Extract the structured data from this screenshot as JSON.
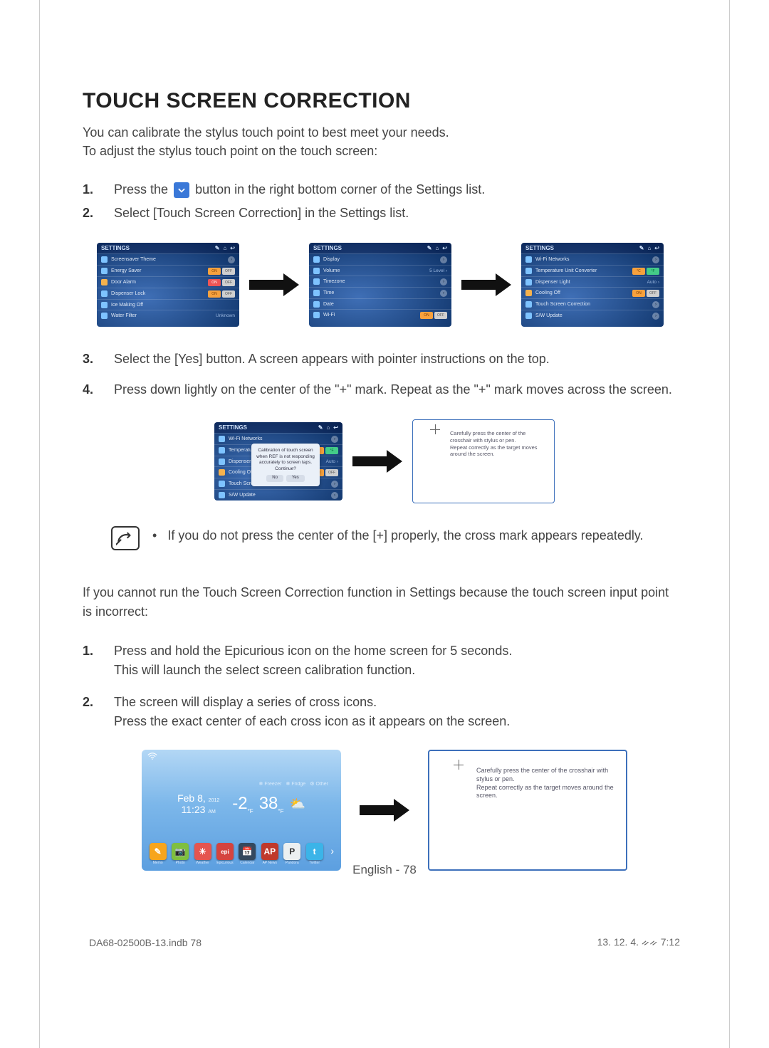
{
  "title": "TOUCH SCREEN CORRECTION",
  "intro_line1": "You can calibrate the stylus touch point to best meet your needs.",
  "intro_line2": "To adjust the stylus touch point on the touch screen:",
  "steps_a": [
    {
      "num": "1.",
      "pre": "Press the ",
      "post": " button in the right bottom corner of the Settings list."
    },
    {
      "num": "2.",
      "text": "Select [Touch Screen Correction] in the Settings list."
    }
  ],
  "settings_header": "SETTINGS",
  "header_icons": {
    "edit": "✎",
    "home": "⌂",
    "back": "↩"
  },
  "screens": {
    "s1": [
      {
        "icon": "#7ec3ff",
        "label": "Screensaver Theme",
        "ctrl": "chev"
      },
      {
        "icon": "#7ec3ff",
        "label": "Energy Saver",
        "ctrl": "onoff"
      },
      {
        "icon": "#f6b24d",
        "label": "Door Alarm",
        "ctrl": "onoff_red"
      },
      {
        "icon": "#7ec3ff",
        "label": "Dispenser Lock",
        "ctrl": "onoff"
      },
      {
        "icon": "#7ec3ff",
        "label": "Ice Making Off",
        "ctrl": "none"
      },
      {
        "icon": "#7ec3ff",
        "label": "Water Filter",
        "ctrl": "muted",
        "right": "Unknown"
      }
    ],
    "s2": [
      {
        "icon": "#7ec3ff",
        "label": "Display",
        "ctrl": "chev"
      },
      {
        "icon": "#7ec3ff",
        "label": "Volume",
        "ctrl": "muted",
        "right": "5 Level ›"
      },
      {
        "icon": "#7ec3ff",
        "label": "Timezone",
        "ctrl": "chev"
      },
      {
        "icon": "#7ec3ff",
        "label": "Time",
        "ctrl": "chev"
      },
      {
        "icon": "#7ec3ff",
        "label": "Date",
        "ctrl": "none"
      },
      {
        "icon": "#7ec3ff",
        "label": "Wi-Fi",
        "ctrl": "onoff"
      }
    ],
    "s3": [
      {
        "icon": "#7ec3ff",
        "label": "Wi-Fi Networks",
        "ctrl": "chev"
      },
      {
        "icon": "#7ec3ff",
        "label": "Temperature Unit Converter",
        "ctrl": "cf"
      },
      {
        "icon": "#7ec3ff",
        "label": "Dispenser Light",
        "ctrl": "muted",
        "right": "Auto ›"
      },
      {
        "icon": "#f6b24d",
        "label": "Cooling Off",
        "ctrl": "onoff"
      },
      {
        "icon": "#7ec3ff",
        "label": "Touch Screen Correction",
        "ctrl": "chev"
      },
      {
        "icon": "#7ec3ff",
        "label": "S/W Update",
        "ctrl": "chev"
      }
    ]
  },
  "steps_b": [
    {
      "num": "3.",
      "text": "Select the [Yes] button. A screen appears with pointer instructions on the top."
    },
    {
      "num": "4.",
      "text": "Press down lightly on the center of the \"+\" mark. Repeat as the \"+\" mark moves across the screen."
    }
  ],
  "dialog": {
    "line1": "Calibration of touch screen",
    "line2": "when REF is not responding",
    "line3": "accurately to screen taps.",
    "line4": "Continue?",
    "no": "No",
    "yes": "Yes"
  },
  "calib_msg_line1": "Carefully press the center of the crosshair with stylus or pen.",
  "calib_msg_line2": "Repeat correctly as the target moves around the screen.",
  "note_bullet": "•",
  "note_text": "If you do not press the center of the [+] properly, the cross mark appears repeatedly.",
  "para2_line1": "If you cannot run the Touch Screen Correction function in Settings because the touch screen input point",
  "para2_line2": "is incorrect:",
  "steps_c": [
    {
      "num": "1.",
      "l1": "Press and hold the Epicurious icon on the home screen for 5 seconds.",
      "l2": "This will launch the select screen calibration function."
    },
    {
      "num": "2.",
      "l1": "The screen will display a series of cross icons.",
      "l2": "Press the exact center of each cross icon as it appears on the screen."
    }
  ],
  "home": {
    "date_main": "Feb 8,",
    "date_year": "2012",
    "time": "11:23",
    "ampm": "AM",
    "t1": "-2",
    "t1u": "°F",
    "t2": "38",
    "t2u": "°F",
    "mini": [
      "Freezer",
      "Fridge",
      "Other"
    ],
    "apps": [
      {
        "color": "#f7a51d",
        "g": "✎",
        "label": "Memo"
      },
      {
        "color": "#7fbf3f",
        "g": "📷",
        "label": "Photo"
      },
      {
        "color": "#e5554f",
        "g": "☀",
        "label": "Weather"
      },
      {
        "color": "#d5443f",
        "g": "epi",
        "label": "Epicurious"
      },
      {
        "color": "#34495e",
        "g": "📅",
        "label": "Calendar"
      },
      {
        "color": "#c0392b",
        "g": "AP",
        "label": "AP News"
      },
      {
        "color": "#ecf0f1",
        "g": "P",
        "label": "Pandora",
        "fg": "#333"
      },
      {
        "color": "#3bb4e8",
        "g": "t",
        "label": "Twitter"
      }
    ]
  },
  "footer_center": "English - 78",
  "footer_left": "DA68-02500B-13.indb   78",
  "footer_right": "13. 12. 4.   ᨀᨀ 7:12"
}
